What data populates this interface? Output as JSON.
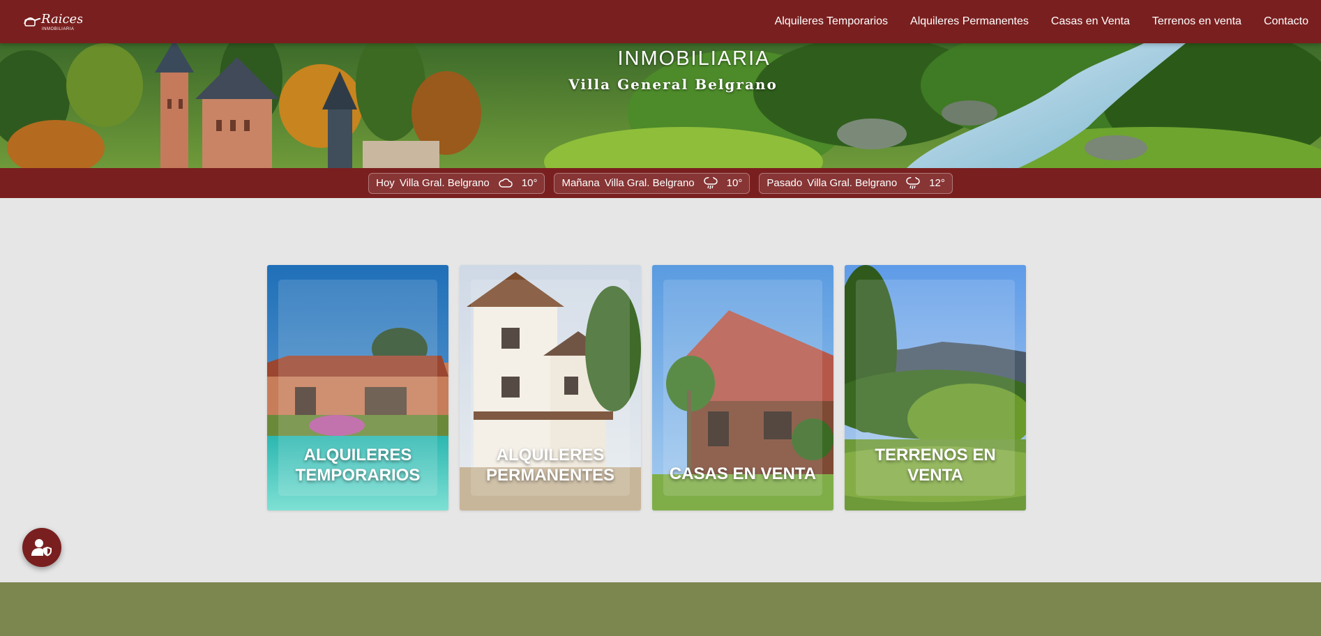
{
  "brand": {
    "logo_text": "Raices",
    "logo_subtext": "INMOBILIARIA",
    "hero_subtitle": "INMOBILIARIA",
    "hero_location": "Villa General Belgrano",
    "color_primary": "#7a1f1f",
    "color_footer": "#7c8750"
  },
  "nav": {
    "items": [
      {
        "label": "Alquileres Temporarios"
      },
      {
        "label": "Alquileres Permanentes"
      },
      {
        "label": "Casas en Venta"
      },
      {
        "label": "Terrenos en venta"
      },
      {
        "label": "Contacto"
      }
    ]
  },
  "weather": [
    {
      "day": "Hoy",
      "place": "Villa Gral. Belgrano",
      "icon": "cloud-icon",
      "temp": "10°"
    },
    {
      "day": "Mañana",
      "place": "Villa Gral. Belgrano",
      "icon": "rain-cloud-icon",
      "temp": "10°"
    },
    {
      "day": "Pasado",
      "place": "Villa Gral. Belgrano",
      "icon": "rain-cloud-icon",
      "temp": "12°"
    }
  ],
  "cards": [
    {
      "title": "ALQUILERES TEMPORARIOS"
    },
    {
      "title": "ALQUILERES PERMANENTES"
    },
    {
      "title": "CASAS EN VENTA"
    },
    {
      "title": "TERRENOS EN VENTA"
    }
  ],
  "privacy_button": {
    "icon": "user-shield-icon"
  }
}
